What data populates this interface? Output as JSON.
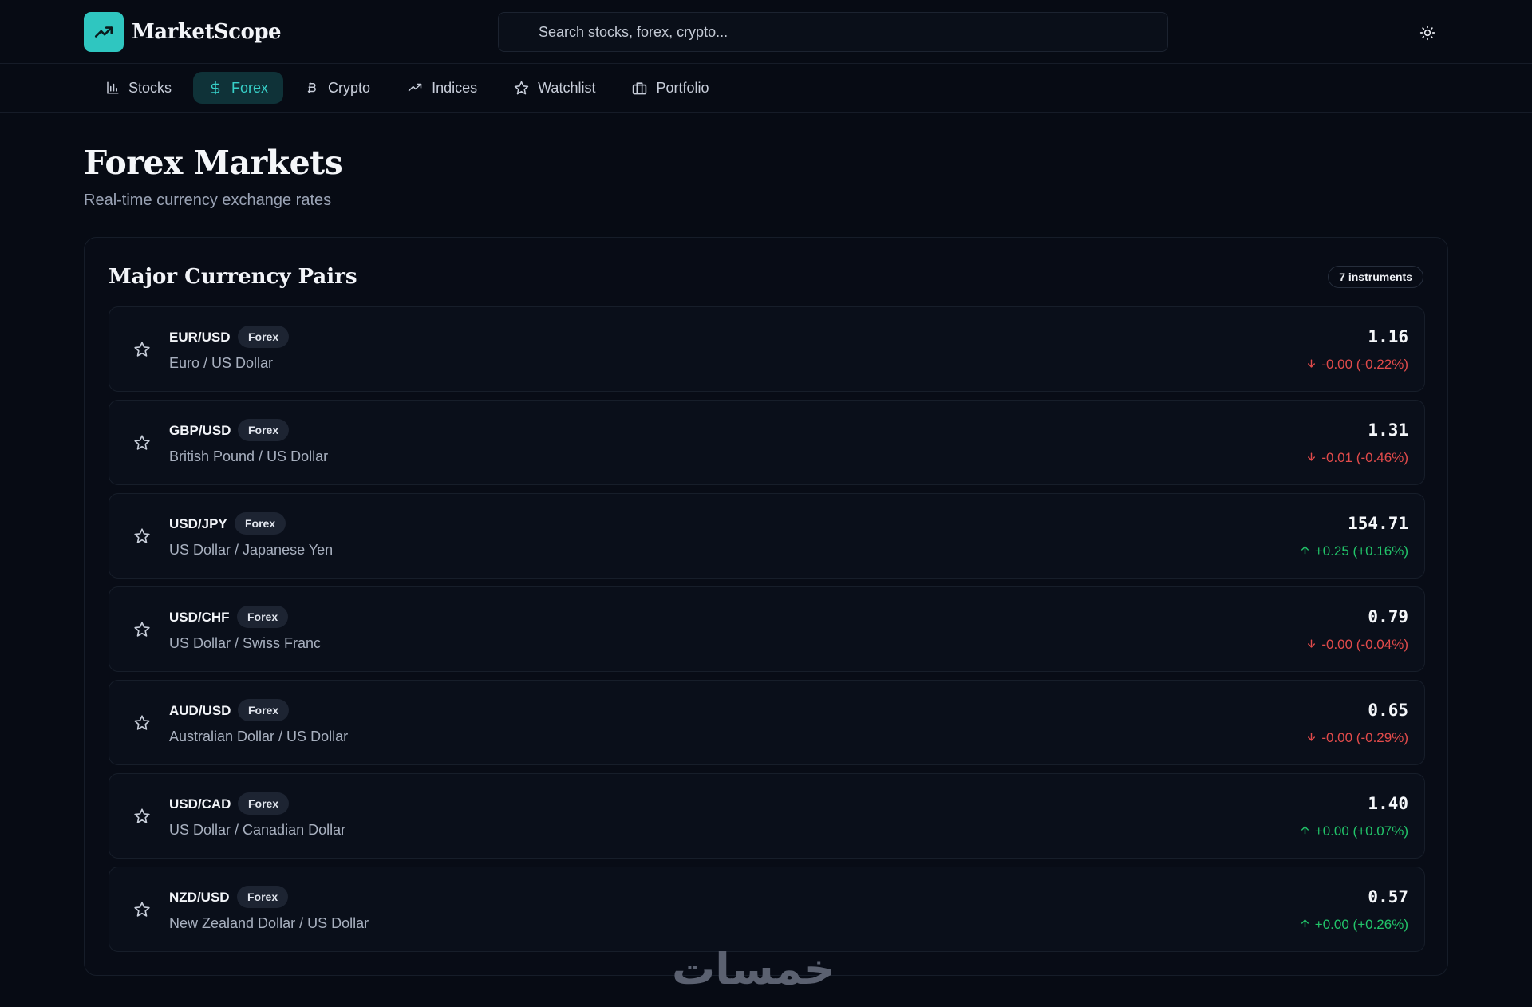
{
  "app": {
    "name": "MarketScope",
    "search_placeholder": "Search stocks, forex, crypto..."
  },
  "nav": [
    {
      "label": "Stocks",
      "icon": "bar-chart-icon",
      "active": false
    },
    {
      "label": "Forex",
      "icon": "dollar-icon",
      "active": true
    },
    {
      "label": "Crypto",
      "icon": "bitcoin-icon",
      "active": false
    },
    {
      "label": "Indices",
      "icon": "trending-up-icon",
      "active": false
    },
    {
      "label": "Watchlist",
      "icon": "star-icon",
      "active": false
    },
    {
      "label": "Portfolio",
      "icon": "briefcase-icon",
      "active": false
    }
  ],
  "page": {
    "title": "Forex Markets",
    "subtitle": "Real-time currency exchange rates"
  },
  "card": {
    "title": "Major Currency Pairs",
    "count_label": "7 instruments"
  },
  "pairs": [
    {
      "symbol": "EUR/USD",
      "badge": "Forex",
      "name": "Euro / US Dollar",
      "price": "1.16",
      "change": "-0.00 (-0.22%)",
      "direction": "down"
    },
    {
      "symbol": "GBP/USD",
      "badge": "Forex",
      "name": "British Pound / US Dollar",
      "price": "1.31",
      "change": "-0.01 (-0.46%)",
      "direction": "down"
    },
    {
      "symbol": "USD/JPY",
      "badge": "Forex",
      "name": "US Dollar / Japanese Yen",
      "price": "154.71",
      "change": "+0.25 (+0.16%)",
      "direction": "up"
    },
    {
      "symbol": "USD/CHF",
      "badge": "Forex",
      "name": "US Dollar / Swiss Franc",
      "price": "0.79",
      "change": "-0.00 (-0.04%)",
      "direction": "down"
    },
    {
      "symbol": "AUD/USD",
      "badge": "Forex",
      "name": "Australian Dollar / US Dollar",
      "price": "0.65",
      "change": "-0.00 (-0.29%)",
      "direction": "down"
    },
    {
      "symbol": "USD/CAD",
      "badge": "Forex",
      "name": "US Dollar / Canadian Dollar",
      "price": "1.40",
      "change": "+0.00 (+0.07%)",
      "direction": "up"
    },
    {
      "symbol": "NZD/USD",
      "badge": "Forex",
      "name": "New Zealand Dollar / US Dollar",
      "price": "0.57",
      "change": "+0.00 (+0.26%)",
      "direction": "up"
    }
  ],
  "watermark": "خمسات",
  "colors": {
    "background": "#070b14",
    "accent": "#2fc6c0",
    "up": "#22c56a",
    "down": "#e24b4b"
  }
}
